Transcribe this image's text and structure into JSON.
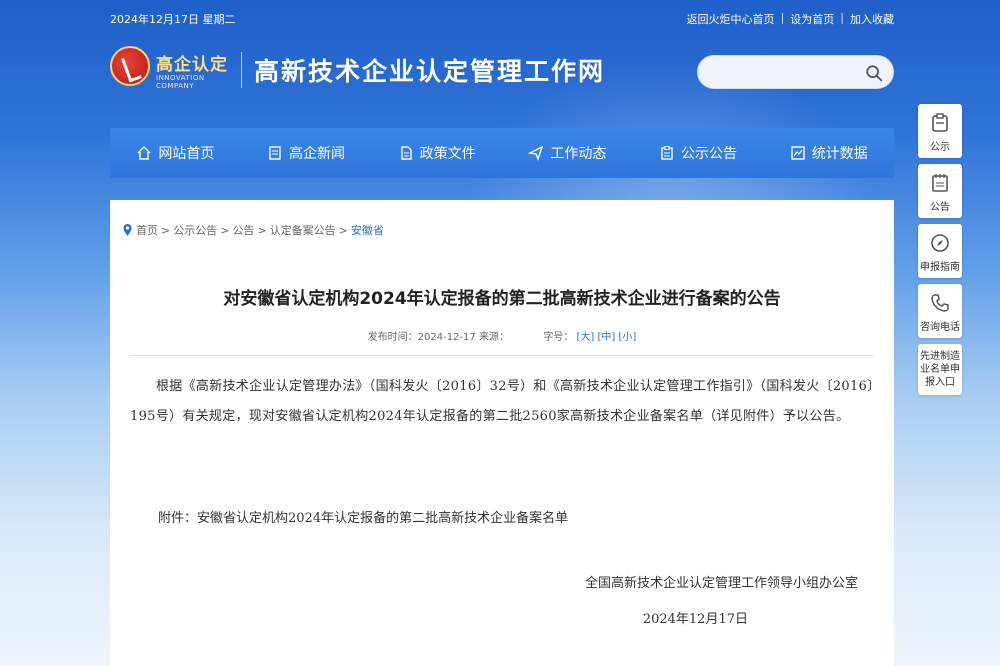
{
  "topbar": {
    "date": "2024年12月17日 星期二",
    "links": [
      "返回火炬中心首页",
      "设为首页",
      "加入收藏"
    ]
  },
  "logo": {
    "name_cn": "高企认定",
    "name_en": "INNOVATION COMPANY"
  },
  "site_title": "高新技术企业认定管理工作网",
  "search": {
    "placeholder": ""
  },
  "nav": [
    {
      "label": "网站首页",
      "icon": "home-icon"
    },
    {
      "label": "高企新闻",
      "icon": "news-icon"
    },
    {
      "label": "政策文件",
      "icon": "document-icon"
    },
    {
      "label": "工作动态",
      "icon": "send-icon"
    },
    {
      "label": "公示公告",
      "icon": "notice-icon"
    },
    {
      "label": "统计数据",
      "icon": "chart-icon"
    }
  ],
  "breadcrumb": [
    "首页",
    "公示公告",
    "公告",
    "认定备案公告",
    "安徽省"
  ],
  "article": {
    "title": "对安徽省认定机构2024年认定报备的第二批高新技术企业进行备案的公告",
    "meta_prefix": "发布时间：2024-12-17 来源：",
    "font_size_label": "字号：",
    "font_sizes": [
      "[大]",
      "[中]",
      "[小]"
    ],
    "body": "根据《高新技术企业认定管理办法》（国科发火〔2016〕32号）和《高新技术企业认定管理工作指引》（国科发火〔2016〕195号）有关规定，现对安徽省认定机构2024年认定报备的第二批2560家高新技术企业备案名单（详见附件）予以公告。",
    "attachment": "附件：安徽省认定机构2024年认定报备的第二批高新技术企业备案名单",
    "signature_org": "全国高新技术企业认定管理工作领导小组办公室",
    "signature_date": "2024年12月17日"
  },
  "side": [
    {
      "label": "公示",
      "icon": "clipboard-icon"
    },
    {
      "label": "公告",
      "icon": "notepad-icon"
    },
    {
      "label": "申报指南",
      "icon": "compass-icon"
    },
    {
      "label": "咨询电话",
      "icon": "phone-icon"
    },
    {
      "label": "先进制造业名单申报入口",
      "icon": ""
    }
  ],
  "colors": {
    "nav": "#2f76dc",
    "link": "#2a6fd6"
  }
}
